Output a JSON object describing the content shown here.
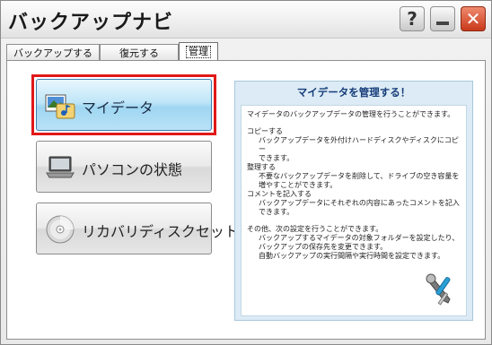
{
  "window": {
    "title": "バックアップナビ",
    "controls": {
      "help": "?",
      "close": "✕"
    }
  },
  "tabs": [
    {
      "label": "バックアップする"
    },
    {
      "label": "復元する"
    },
    {
      "label": "管理",
      "selected": true
    }
  ],
  "buttons": {
    "mydata": "マイデータ",
    "pc_status": "パソコンの状態",
    "recovery_disc": "リカバリディスクセット"
  },
  "info": {
    "title": "マイデータを管理する！",
    "intro": "マイデータのバックアップデータの管理を行うことができます。",
    "copy_heading": "コピーする",
    "copy_desc_1": "バックアップデータを外付けハードディスクやディスクにコピー",
    "copy_desc_2": "できます。",
    "organize_heading": "整理する",
    "organize_desc_1": "不要なバックアップデータを削除して、ドライブの空き容量を",
    "organize_desc_2": "増やすことができます。",
    "comment_heading": "コメントを記入する",
    "comment_desc_1": "バックアップデータにそれぞれの内容にあったコメントを記入",
    "comment_desc_2": "できます。",
    "other_heading": "その他、次の設定を行うことができます。",
    "other_desc_1": "バックアップするマイデータの対象フォルダーを設定したり、",
    "other_desc_2": "バックアップの保存先を変更できます。",
    "other_desc_3": "自動バックアップの実行間隔や実行時間を設定できます。"
  },
  "colors": {
    "accent_border": "#e01818",
    "info_title": "#163d7a",
    "close_button": "#c8381a"
  },
  "icons": {
    "mydata": "photo-music-folder-icon",
    "pc_status": "laptop-icon",
    "recovery_disc": "disc-icon",
    "settings": "wrench-screwdriver-icon"
  }
}
